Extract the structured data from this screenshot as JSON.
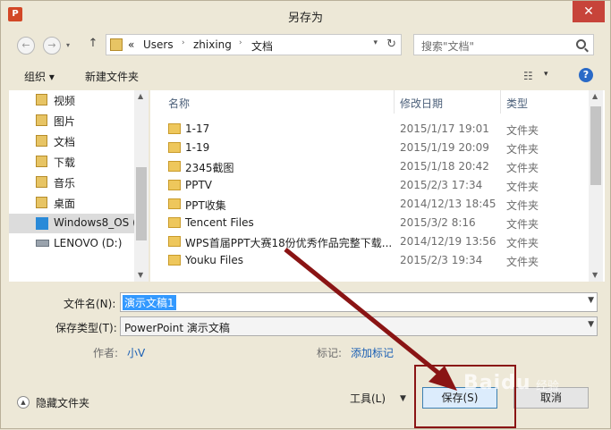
{
  "window": {
    "title": "另存为",
    "app_icon": "P",
    "close": "✕"
  },
  "address": {
    "back": "←",
    "forward": "→",
    "up": "↑",
    "path": [
      "«",
      "Users",
      "zhixing",
      "文档"
    ],
    "dropdown": "▾",
    "refresh": "↻",
    "search_placeholder": "搜索\"文档\""
  },
  "toolbar": {
    "organize": "组织 ▾",
    "new_folder": "新建文件夹",
    "view": "☷",
    "view_dropdown": "▾",
    "help": "?"
  },
  "sidebar": {
    "items": [
      {
        "label": "视频"
      },
      {
        "label": "图片"
      },
      {
        "label": "文档"
      },
      {
        "label": "下载"
      },
      {
        "label": "音乐"
      },
      {
        "label": "桌面"
      },
      {
        "label": "Windows8_OS ("
      },
      {
        "label": "LENOVO (D:)"
      }
    ]
  },
  "files": {
    "columns": {
      "name": "名称",
      "date": "修改日期",
      "type": "类型"
    },
    "rows": [
      {
        "name": "1-17",
        "date": "2015/1/17 19:01",
        "type": "文件夹"
      },
      {
        "name": "1-19",
        "date": "2015/1/19 20:09",
        "type": "文件夹"
      },
      {
        "name": "2345截图",
        "date": "2015/1/18 20:42",
        "type": "文件夹"
      },
      {
        "name": "PPTV",
        "date": "2015/2/3 17:34",
        "type": "文件夹"
      },
      {
        "name": "PPT收集",
        "date": "2014/12/13 18:45",
        "type": "文件夹"
      },
      {
        "name": "Tencent Files",
        "date": "2015/3/2 8:16",
        "type": "文件夹"
      },
      {
        "name": "WPS首届PPT大赛18份优秀作品完整下载...",
        "date": "2014/12/19 13:56",
        "type": "文件夹"
      },
      {
        "name": "Youku Files",
        "date": "2015/2/3 19:34",
        "type": "文件夹"
      }
    ]
  },
  "form": {
    "filename_label": "文件名(N):",
    "filename_value": "演示文稿1",
    "filetype_label": "保存类型(T):",
    "filetype_value": "PowerPoint 演示文稿",
    "author_label": "作者:",
    "author_value": "小V",
    "tags_label": "标记:",
    "tags_value": "添加标记"
  },
  "footer": {
    "hide_folders": "隐藏文件夹",
    "tools": "工具(L)",
    "save": "保存(S)",
    "cancel": "取消"
  },
  "watermark": {
    "text": "Baidu",
    "sub": "经验"
  },
  "colors": {
    "selection": "#3399ff",
    "annotation": "#8a1414",
    "link": "#1a5fb4"
  }
}
